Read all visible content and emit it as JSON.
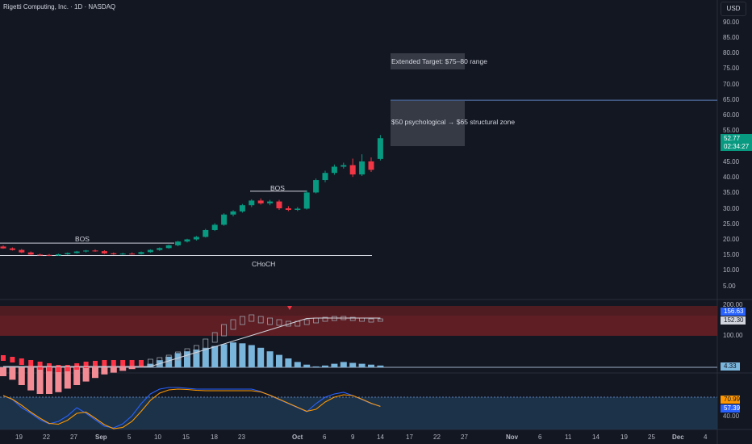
{
  "header": {
    "title": "Rigetti Computing, Inc. · 1D · NASDAQ",
    "currency": "USD"
  },
  "price_axis": {
    "ticks": [
      "90.00",
      "85.00",
      "80.00",
      "75.00",
      "70.00",
      "65.00",
      "60.00",
      "55.00",
      "45.00",
      "40.00",
      "35.00",
      "30.00",
      "25.00",
      "20.00",
      "15.00",
      "10.00",
      "5.00"
    ]
  },
  "last_price": {
    "value": "52.77",
    "countdown": "02:34:27"
  },
  "annotations": {
    "extended_target": "Extended Target: $75–80 range",
    "structural_zone": "$50 psychological → $65 structural zone",
    "bos_1": "BOS",
    "bos_2": "BOS",
    "choch": "CHoCH"
  },
  "indicator1": {
    "axis": [
      "200.00",
      "100.00"
    ],
    "badges": {
      "a": "156.63",
      "b": "152.30",
      "c": "4.33"
    }
  },
  "indicator2": {
    "axis": [
      "40.00"
    ],
    "badges": {
      "a": "70.99",
      "b": "57.39"
    }
  },
  "time_axis": [
    "19",
    "22",
    "27",
    "Sep",
    "5",
    "10",
    "15",
    "18",
    "23",
    "Oct",
    "6",
    "9",
    "14",
    "17",
    "22",
    "27",
    "Nov",
    "6",
    "11",
    "14",
    "19",
    "25",
    "Dec",
    "4"
  ],
  "colors": {
    "bg": "#131722",
    "up": "#089981",
    "down": "#f23645",
    "blue": "#2962ff",
    "orange": "#ff9800",
    "hist": "#7ab5dc"
  },
  "chart_data": {
    "type": "candlestick",
    "title": "Rigetti Computing, Inc. · 1D · NASDAQ",
    "ylim": [
      0,
      92
    ],
    "candles": [
      {
        "o": 17.9,
        "h": 18.3,
        "l": 17.2,
        "c": 17.3
      },
      {
        "o": 17.3,
        "h": 17.6,
        "l": 16.6,
        "c": 16.8
      },
      {
        "o": 16.8,
        "h": 17.1,
        "l": 15.8,
        "c": 16.0
      },
      {
        "o": 16.0,
        "h": 16.3,
        "l": 15.2,
        "c": 15.3
      },
      {
        "o": 15.3,
        "h": 15.6,
        "l": 14.9,
        "c": 15.2
      },
      {
        "o": 15.2,
        "h": 15.5,
        "l": 14.8,
        "c": 15.0
      },
      {
        "o": 15.0,
        "h": 15.6,
        "l": 14.9,
        "c": 15.4
      },
      {
        "o": 15.4,
        "h": 16.0,
        "l": 15.2,
        "c": 15.8
      },
      {
        "o": 15.8,
        "h": 16.5,
        "l": 15.6,
        "c": 16.3
      },
      {
        "o": 16.3,
        "h": 16.8,
        "l": 16.0,
        "c": 16.6
      },
      {
        "o": 16.6,
        "h": 17.0,
        "l": 16.2,
        "c": 16.4
      },
      {
        "o": 16.4,
        "h": 16.7,
        "l": 15.5,
        "c": 15.7
      },
      {
        "o": 15.7,
        "h": 16.0,
        "l": 15.2,
        "c": 15.4
      },
      {
        "o": 15.4,
        "h": 15.9,
        "l": 15.2,
        "c": 15.6
      },
      {
        "o": 15.6,
        "h": 16.0,
        "l": 15.3,
        "c": 15.5
      },
      {
        "o": 15.5,
        "h": 16.3,
        "l": 15.3,
        "c": 16.1
      },
      {
        "o": 16.1,
        "h": 17.0,
        "l": 15.9,
        "c": 16.8
      },
      {
        "o": 16.8,
        "h": 17.6,
        "l": 16.5,
        "c": 17.4
      },
      {
        "o": 17.4,
        "h": 18.5,
        "l": 17.2,
        "c": 18.3
      },
      {
        "o": 18.3,
        "h": 19.7,
        "l": 18.0,
        "c": 19.5
      },
      {
        "o": 19.5,
        "h": 20.4,
        "l": 19.2,
        "c": 20.2
      },
      {
        "o": 20.2,
        "h": 21.3,
        "l": 19.8,
        "c": 21.0
      },
      {
        "o": 21.0,
        "h": 23.6,
        "l": 20.8,
        "c": 23.2
      },
      {
        "o": 23.2,
        "h": 25.4,
        "l": 22.9,
        "c": 24.9
      },
      {
        "o": 24.9,
        "h": 28.6,
        "l": 24.6,
        "c": 28.2
      },
      {
        "o": 28.2,
        "h": 29.6,
        "l": 27.6,
        "c": 29.2
      },
      {
        "o": 29.2,
        "h": 31.6,
        "l": 28.8,
        "c": 31.2
      },
      {
        "o": 31.2,
        "h": 33.1,
        "l": 30.6,
        "c": 32.7
      },
      {
        "o": 32.7,
        "h": 33.4,
        "l": 31.4,
        "c": 31.8
      },
      {
        "o": 31.8,
        "h": 32.9,
        "l": 31.2,
        "c": 32.4
      },
      {
        "o": 32.4,
        "h": 32.9,
        "l": 29.7,
        "c": 30.2
      },
      {
        "o": 30.2,
        "h": 30.9,
        "l": 29.3,
        "c": 29.7
      },
      {
        "o": 29.7,
        "h": 30.6,
        "l": 29.3,
        "c": 30.1
      },
      {
        "o": 30.1,
        "h": 36.0,
        "l": 29.8,
        "c": 35.3
      },
      {
        "o": 35.3,
        "h": 39.8,
        "l": 35.0,
        "c": 39.3
      },
      {
        "o": 39.3,
        "h": 42.3,
        "l": 38.6,
        "c": 41.6
      },
      {
        "o": 41.6,
        "h": 44.3,
        "l": 41.0,
        "c": 43.6
      },
      {
        "o": 43.6,
        "h": 44.9,
        "l": 43.0,
        "c": 44.1
      },
      {
        "o": 44.1,
        "h": 46.2,
        "l": 40.3,
        "c": 41.1
      },
      {
        "o": 41.1,
        "h": 47.6,
        "l": 40.6,
        "c": 45.3
      },
      {
        "o": 45.3,
        "h": 46.6,
        "l": 41.9,
        "c": 42.6
      },
      {
        "o": 46.1,
        "h": 53.8,
        "l": 45.6,
        "c": 52.77
      }
    ],
    "levels": {
      "bos_1": 19.0,
      "bos_2": 35.7,
      "choch": 15.0,
      "target_line": 65.0
    },
    "zones": {
      "extended_target": [
        80.5,
        75.5
      ],
      "structural_zone": [
        65.0,
        50.0
      ]
    }
  }
}
